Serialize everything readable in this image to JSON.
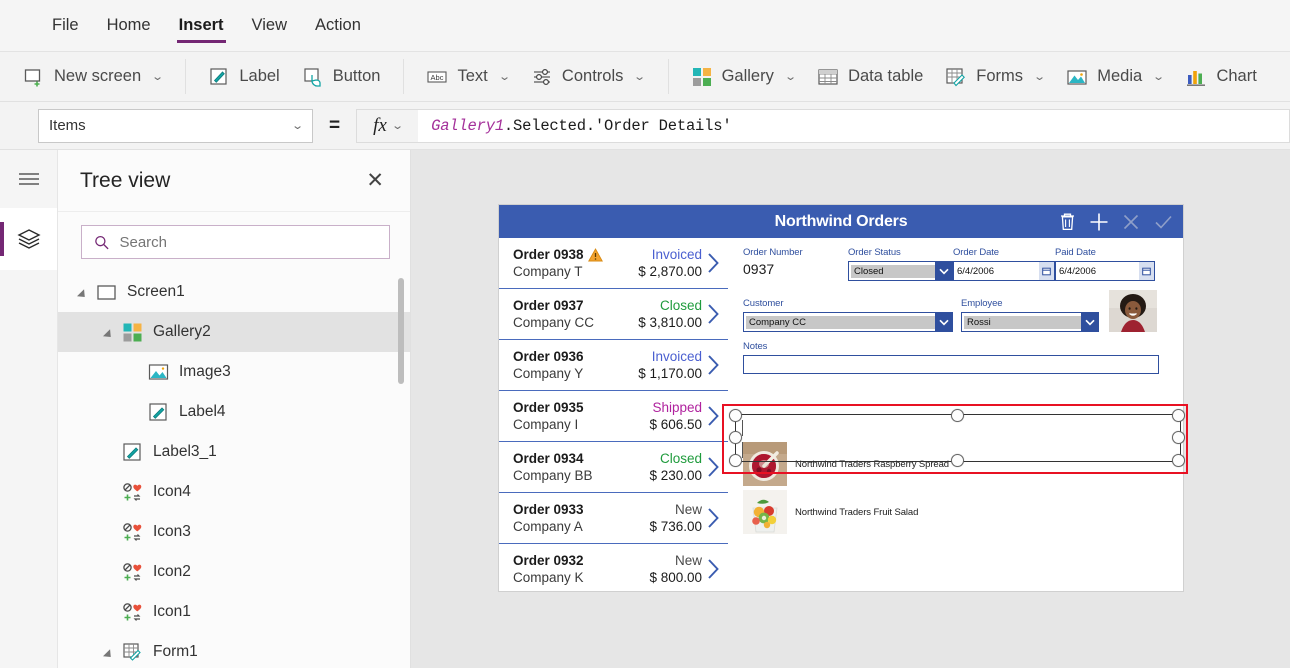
{
  "menubar": {
    "items": [
      {
        "label": "File",
        "active": false
      },
      {
        "label": "Home",
        "active": false
      },
      {
        "label": "Insert",
        "active": true
      },
      {
        "label": "View",
        "active": false
      },
      {
        "label": "Action",
        "active": false
      }
    ]
  },
  "ribbon": {
    "groups": [
      {
        "items": [
          {
            "label": "New screen",
            "icon": "new-screen-icon",
            "caret": true
          }
        ]
      },
      {
        "items": [
          {
            "label": "Label",
            "icon": "label-icon",
            "caret": false
          },
          {
            "label": "Button",
            "icon": "button-icon",
            "caret": false
          }
        ]
      },
      {
        "items": [
          {
            "label": "Text",
            "icon": "text-icon",
            "caret": true
          },
          {
            "label": "Controls",
            "icon": "controls-icon",
            "caret": true
          }
        ]
      },
      {
        "items": [
          {
            "label": "Gallery",
            "icon": "gallery-icon",
            "caret": true
          },
          {
            "label": "Data table",
            "icon": "data-table-icon",
            "caret": false
          },
          {
            "label": "Forms",
            "icon": "forms-icon",
            "caret": true
          },
          {
            "label": "Media",
            "icon": "media-icon",
            "caret": true
          },
          {
            "label": "Chart",
            "icon": "chart-icon",
            "caret": false
          }
        ]
      }
    ]
  },
  "formula_bar": {
    "property": "Items",
    "equals": "=",
    "fx": "fx",
    "expression_var": "Gallery1",
    "expression_rest": ".Selected.'Order Details'"
  },
  "tree_panel": {
    "title": "Tree view",
    "close": "✕",
    "search_placeholder": "Search",
    "search_value": "",
    "nodes": [
      {
        "label": "Screen1",
        "depth": 0,
        "icon": "screen-icon",
        "arrow": true,
        "selected": false
      },
      {
        "label": "Gallery2",
        "depth": 1,
        "icon": "gallery-icon",
        "arrow": true,
        "selected": true
      },
      {
        "label": "Image3",
        "depth": 2,
        "icon": "image-icon",
        "arrow": false,
        "selected": false
      },
      {
        "label": "Label4",
        "depth": 2,
        "icon": "label-icon",
        "arrow": false,
        "selected": false
      },
      {
        "label": "Label3_1",
        "depth": 1,
        "icon": "label-icon",
        "arrow": false,
        "selected": false
      },
      {
        "label": "Icon4",
        "depth": 1,
        "icon": "icons-icon",
        "arrow": false,
        "selected": false
      },
      {
        "label": "Icon3",
        "depth": 1,
        "icon": "icons-icon",
        "arrow": false,
        "selected": false
      },
      {
        "label": "Icon2",
        "depth": 1,
        "icon": "icons-icon",
        "arrow": false,
        "selected": false
      },
      {
        "label": "Icon1",
        "depth": 1,
        "icon": "icons-icon",
        "arrow": false,
        "selected": false
      },
      {
        "label": "Form1",
        "depth": 1,
        "icon": "form-icon",
        "arrow": true,
        "selected": false
      }
    ]
  },
  "app": {
    "title": "Northwind Orders",
    "header_icons": [
      {
        "name": "delete-icon",
        "glyph": "trash",
        "dim": false
      },
      {
        "name": "add-icon",
        "glyph": "plus",
        "dim": false
      },
      {
        "name": "cancel-icon",
        "glyph": "x",
        "dim": true
      },
      {
        "name": "save-icon",
        "glyph": "check",
        "dim": true
      }
    ],
    "orders": [
      {
        "number": "Order 0938",
        "company": "Company T",
        "status": "Invoiced",
        "amount": "$ 2,870.00",
        "warning": true
      },
      {
        "number": "Order 0937",
        "company": "Company CC",
        "status": "Closed",
        "amount": "$ 3,810.00",
        "warning": false
      },
      {
        "number": "Order 0936",
        "company": "Company Y",
        "status": "Invoiced",
        "amount": "$ 1,170.00",
        "warning": false
      },
      {
        "number": "Order 0935",
        "company": "Company I",
        "status": "Shipped",
        "amount": "$ 606.50",
        "warning": false
      },
      {
        "number": "Order 0934",
        "company": "Company BB",
        "status": "Closed",
        "amount": "$ 230.00",
        "warning": false
      },
      {
        "number": "Order 0933",
        "company": "Company A",
        "status": "New",
        "amount": "$ 736.00",
        "warning": false
      },
      {
        "number": "Order 0932",
        "company": "Company K",
        "status": "New",
        "amount": "$ 800.00",
        "warning": false
      }
    ],
    "status_colors": {
      "Invoiced": "#4a5fd0",
      "Closed": "#1f9b3c",
      "Shipped": "#b0229e",
      "New": "#4a4a4a"
    },
    "form": {
      "order_number_label": "Order Number",
      "order_number_value": "0937",
      "order_status_label": "Order Status",
      "order_status_value": "Closed",
      "order_date_label": "Order Date",
      "order_date_value": "6/4/2006",
      "paid_date_label": "Paid Date",
      "paid_date_value": "6/4/2006",
      "customer_label": "Customer",
      "customer_value": "Company CC",
      "employee_label": "Employee",
      "employee_value": "Rossi",
      "notes_label": "Notes",
      "notes_value": ""
    },
    "details": [
      {
        "name": "Northwind Traders Raspberry Spread",
        "thumb": "raspberry-spread-thumb",
        "selected": true
      },
      {
        "name": "Northwind Traders Fruit Salad",
        "thumb": "fruit-salad-thumb",
        "selected": false
      }
    ]
  },
  "colors": {
    "accent_purple": "#742774",
    "app_header_blue": "#3a5cb0",
    "form_label_blue": "#2f4f9e",
    "selection_red": "#e81123"
  }
}
